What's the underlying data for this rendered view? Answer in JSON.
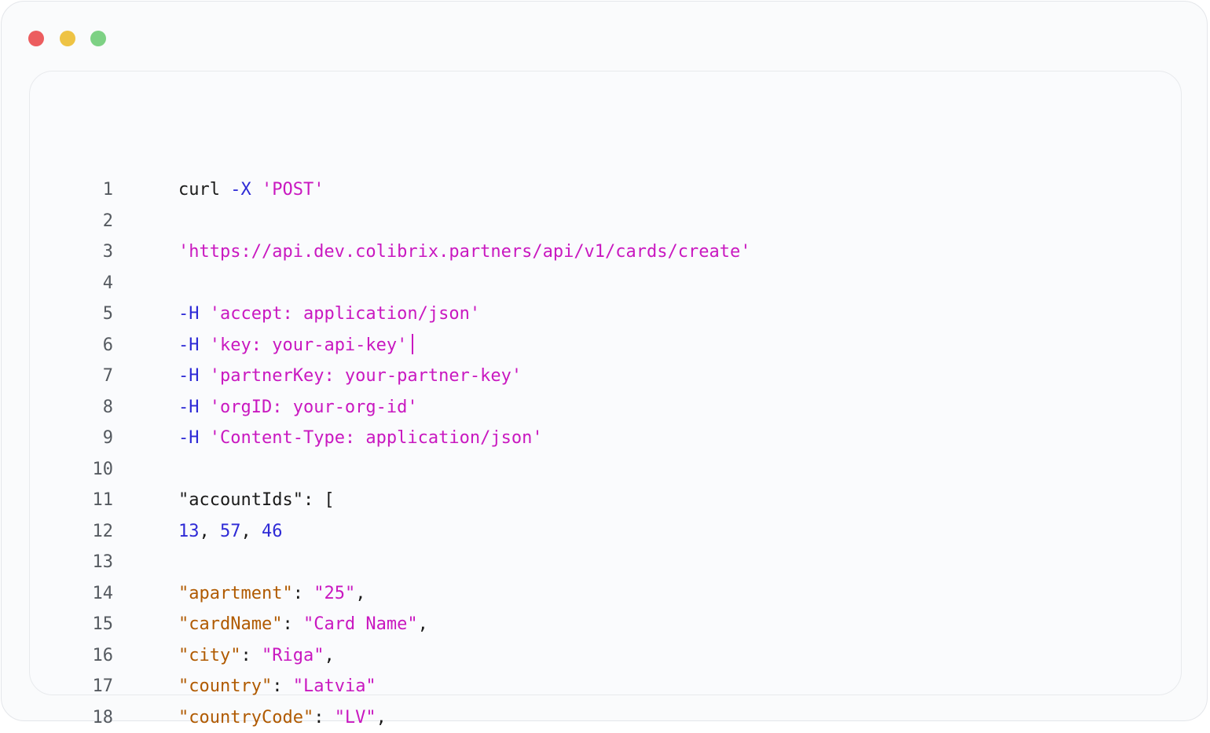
{
  "window": {
    "controls": [
      "close",
      "minimize",
      "maximize"
    ],
    "colors": {
      "close": "#ec5d5f",
      "minimize": "#eec344",
      "maximize": "#7dd184"
    }
  },
  "code": {
    "lines": [
      {
        "n": "1",
        "tokens": [
          {
            "t": "curl ",
            "c": "plain"
          },
          {
            "t": "-X",
            "c": "flag"
          },
          {
            "t": " ",
            "c": "plain"
          },
          {
            "t": "'POST'",
            "c": "str"
          }
        ]
      },
      {
        "n": "2",
        "tokens": []
      },
      {
        "n": "3",
        "tokens": [
          {
            "t": "'https://api.dev.colibrix.partners/api/v1/cards/create'",
            "c": "str"
          }
        ]
      },
      {
        "n": "4",
        "tokens": []
      },
      {
        "n": "5",
        "tokens": [
          {
            "t": "-H",
            "c": "flag"
          },
          {
            "t": " ",
            "c": "plain"
          },
          {
            "t": "'accept: application/json'",
            "c": "str"
          }
        ]
      },
      {
        "n": "6",
        "tokens": [
          {
            "t": "-H",
            "c": "flag"
          },
          {
            "t": " ",
            "c": "plain"
          },
          {
            "t": "'key: your-api-key'",
            "c": "str"
          }
        ],
        "caret": true
      },
      {
        "n": "7",
        "tokens": [
          {
            "t": "-H",
            "c": "flag"
          },
          {
            "t": " ",
            "c": "plain"
          },
          {
            "t": "'partnerKey: your-partner-key'",
            "c": "str"
          }
        ]
      },
      {
        "n": "8",
        "tokens": [
          {
            "t": "-H",
            "c": "flag"
          },
          {
            "t": " ",
            "c": "plain"
          },
          {
            "t": "'orgID: your-org-id'",
            "c": "str"
          }
        ]
      },
      {
        "n": "9",
        "tokens": [
          {
            "t": "-H",
            "c": "flag"
          },
          {
            "t": " ",
            "c": "plain"
          },
          {
            "t": "'Content-Type: application/json'",
            "c": "str"
          }
        ]
      },
      {
        "n": "10",
        "tokens": []
      },
      {
        "n": "11",
        "tokens": [
          {
            "t": "\"accountIds\": [",
            "c": "plain"
          }
        ]
      },
      {
        "n": "12",
        "tokens": [
          {
            "t": "13",
            "c": "num"
          },
          {
            "t": ", ",
            "c": "plain"
          },
          {
            "t": "57",
            "c": "num"
          },
          {
            "t": ", ",
            "c": "plain"
          },
          {
            "t": "46",
            "c": "num"
          }
        ]
      },
      {
        "n": "13",
        "tokens": []
      },
      {
        "n": "14",
        "tokens": [
          {
            "t": "\"apartment\"",
            "c": "key"
          },
          {
            "t": ": ",
            "c": "plain"
          },
          {
            "t": "\"25\"",
            "c": "str"
          },
          {
            "t": ",",
            "c": "plain"
          }
        ]
      },
      {
        "n": "15",
        "tokens": [
          {
            "t": "\"cardName\"",
            "c": "key"
          },
          {
            "t": ": ",
            "c": "plain"
          },
          {
            "t": "\"Card Name\"",
            "c": "str"
          },
          {
            "t": ",",
            "c": "plain"
          }
        ]
      },
      {
        "n": "16",
        "tokens": [
          {
            "t": "\"city\"",
            "c": "key"
          },
          {
            "t": ": ",
            "c": "plain"
          },
          {
            "t": "\"Riga\"",
            "c": "str"
          },
          {
            "t": ",",
            "c": "plain"
          }
        ]
      },
      {
        "n": "17",
        "tokens": [
          {
            "t": "\"country\"",
            "c": "key"
          },
          {
            "t": ": ",
            "c": "plain"
          },
          {
            "t": "\"Latvia\"",
            "c": "str"
          }
        ]
      },
      {
        "n": "18",
        "tokens": [
          {
            "t": "\"countryCode\"",
            "c": "key"
          },
          {
            "t": ": ",
            "c": "plain"
          },
          {
            "t": "\"LV\"",
            "c": "str"
          },
          {
            "t": ",",
            "c": "plain"
          }
        ]
      }
    ],
    "token_colors": {
      "plain": "#1a1a1a",
      "flag": "#2e2ad6",
      "str": "#c918c0",
      "num": "#2e2ad6",
      "key": "#b05a00"
    }
  }
}
